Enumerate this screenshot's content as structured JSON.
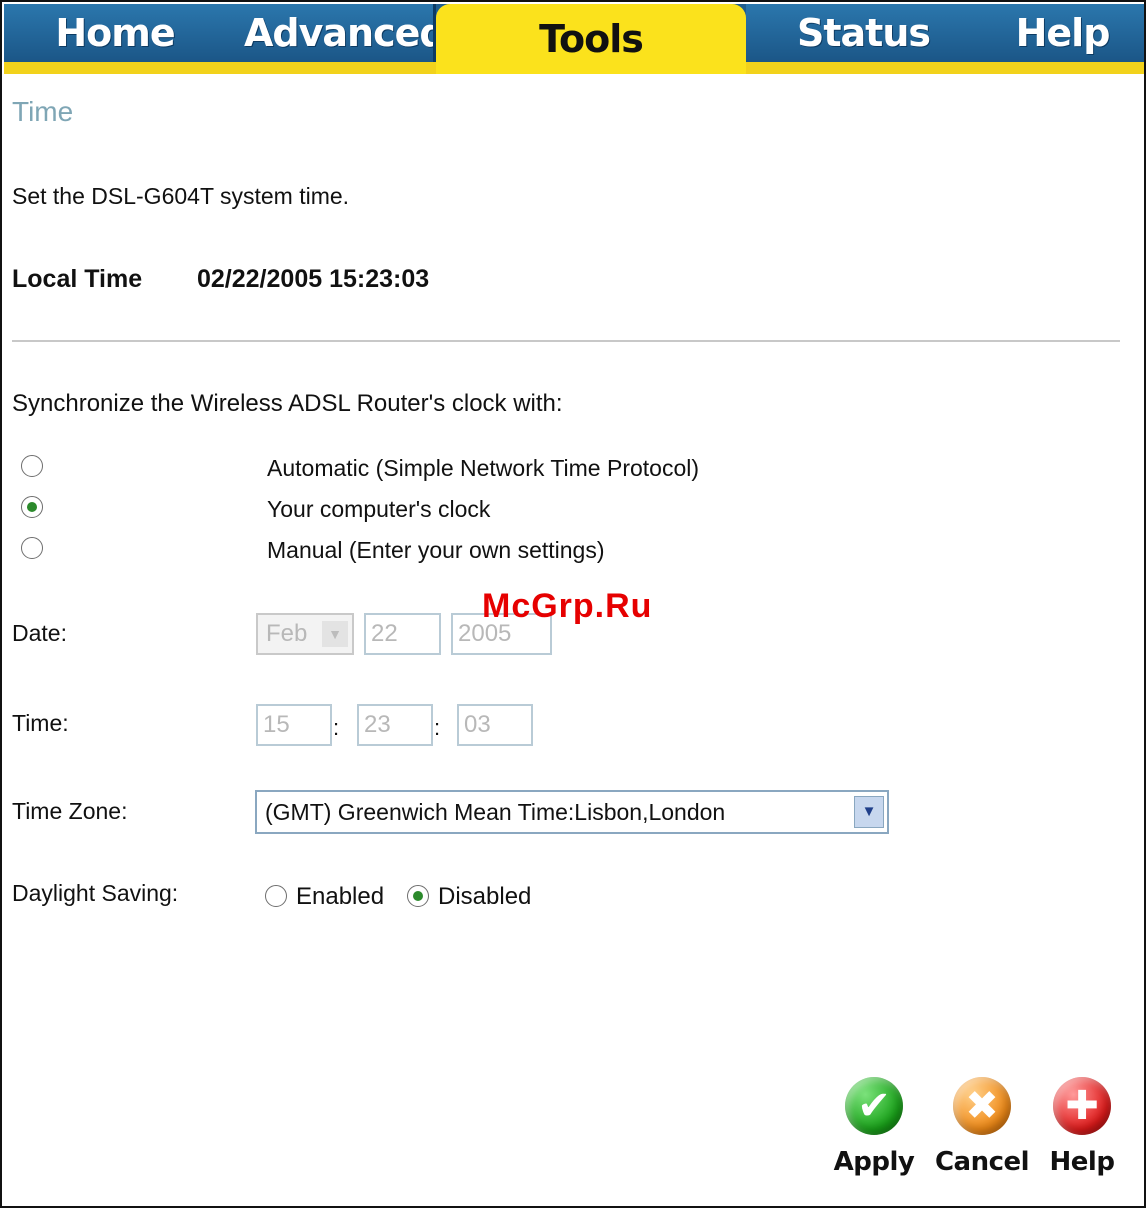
{
  "nav": {
    "tabs": [
      {
        "label": "Home"
      },
      {
        "label": "Advanced"
      },
      {
        "label": "Tools"
      },
      {
        "label": "Status"
      },
      {
        "label": "Help"
      }
    ],
    "active": "Tools"
  },
  "page": {
    "title": "Time",
    "description": "Set the DSL-G604T system time.",
    "local_time_label": "Local Time",
    "local_time_value": "02/22/2005 15:23:03"
  },
  "sync": {
    "heading": "Synchronize the Wireless ADSL Router's clock with:",
    "options": [
      {
        "label": "Automatic (Simple Network Time Protocol)",
        "checked": false
      },
      {
        "label": "Your computer's clock",
        "checked": true
      },
      {
        "label": "Manual (Enter your own settings)",
        "checked": false
      }
    ]
  },
  "date": {
    "label": "Date:",
    "month": "Feb",
    "day": "22",
    "year": "2005"
  },
  "time": {
    "label": "Time:",
    "hour": "15",
    "minute": "23",
    "second": "03",
    "separator": ":"
  },
  "timezone": {
    "label": "Time Zone:",
    "value": "(GMT) Greenwich Mean Time:Lisbon,London"
  },
  "daylight": {
    "label": "Daylight Saving:",
    "enabled_label": "Enabled",
    "disabled_label": "Disabled",
    "selected": "Disabled"
  },
  "actions": {
    "apply": "Apply",
    "cancel": "Cancel",
    "help": "Help"
  },
  "watermark": "McGrp.Ru",
  "colors": {
    "tab_blue": "#1f5d8e",
    "tab_active": "#fbe21c",
    "title": "#7fa6b5",
    "apply_green": "#1aa31a",
    "cancel_orange": "#f08a17",
    "help_red": "#e01b1b"
  }
}
